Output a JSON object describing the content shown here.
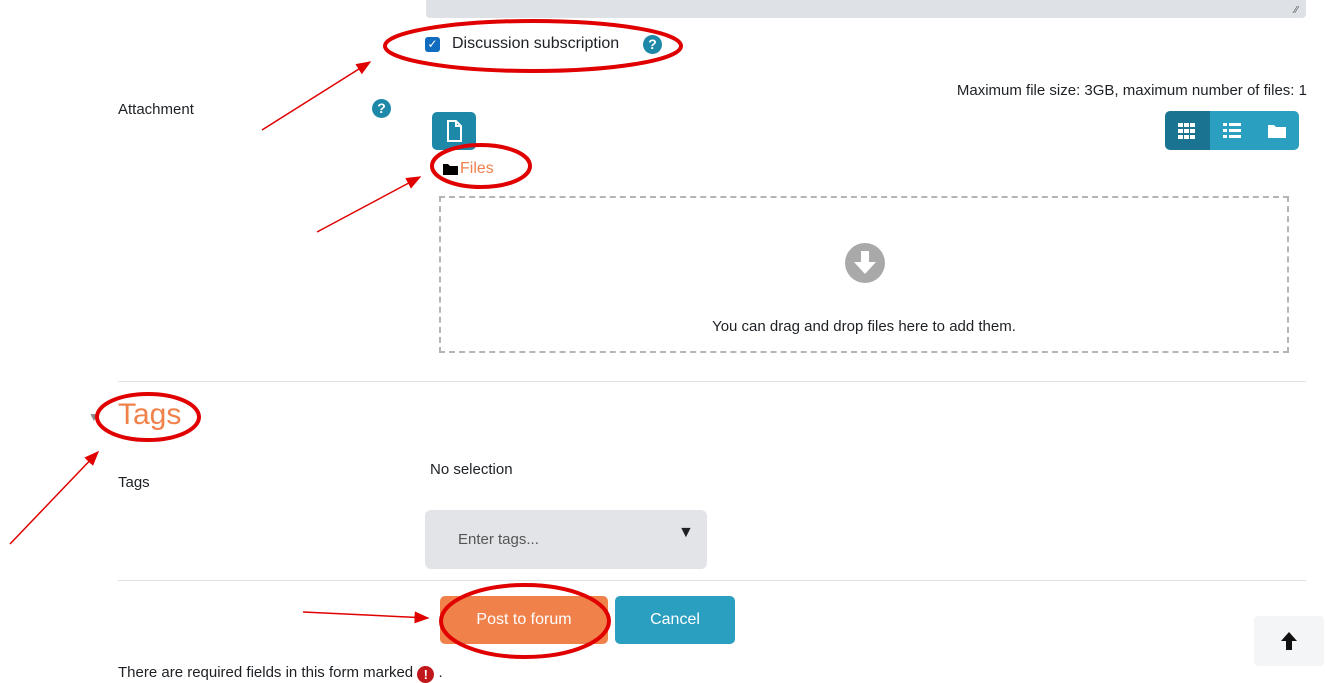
{
  "subscription": {
    "label": "Discussion subscription",
    "checked": true
  },
  "attachment": {
    "label": "Attachment",
    "max_info": "Maximum file size: 3GB, maximum number of files: 1",
    "files_link": "Files",
    "drop_text": "You can drag and drop files here to add them."
  },
  "tags_section": {
    "heading": "Tags",
    "field_label": "Tags",
    "selection_text": "No selection",
    "input_placeholder": "Enter tags..."
  },
  "buttons": {
    "post": "Post to forum",
    "cancel": "Cancel"
  },
  "footer": {
    "required_note": "There are required fields in this form marked",
    "required_suffix": "."
  },
  "colors": {
    "accent_orange": "#f0814b",
    "accent_teal": "#2a9fc0",
    "annotation_red": "#e00000",
    "required_red": "#c0171b"
  },
  "icons": [
    "help-icon",
    "file-icon",
    "grid-view-icon",
    "list-view-icon",
    "tree-view-icon",
    "folder-icon",
    "download-arrow-icon",
    "dropdown-triangle-icon",
    "arrow-up-icon",
    "exclamation-icon"
  ]
}
